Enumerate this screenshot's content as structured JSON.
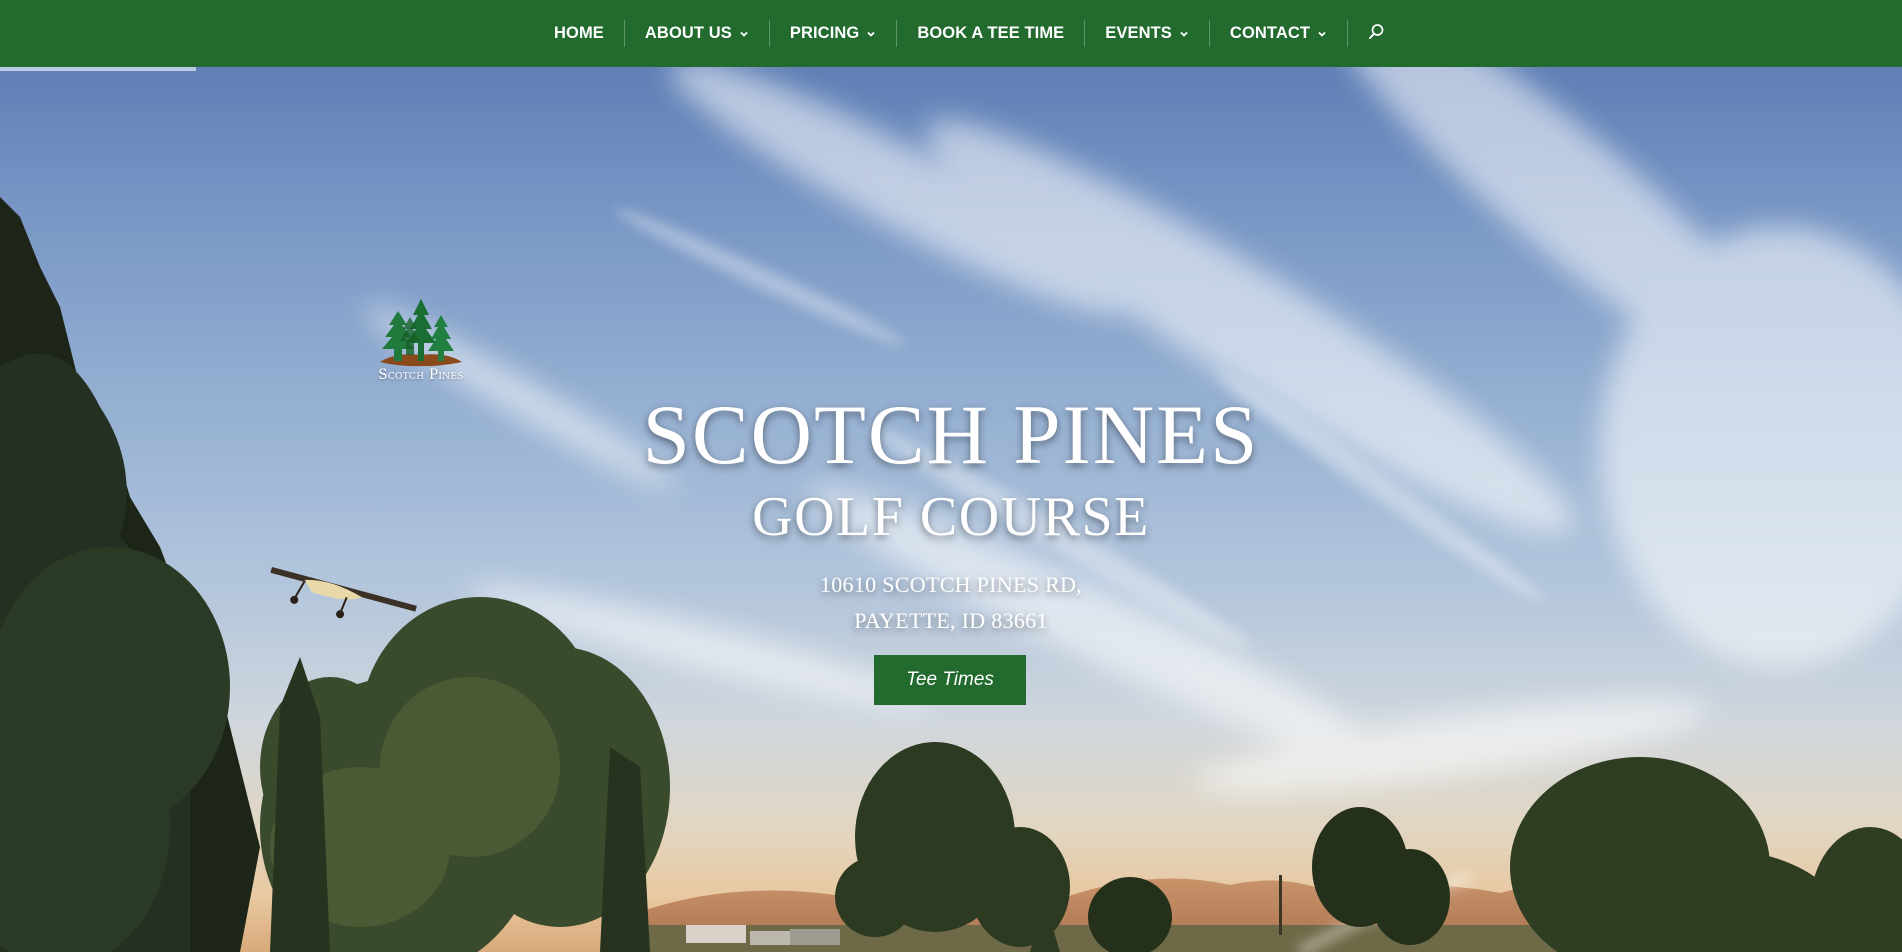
{
  "nav": {
    "items": [
      {
        "label": "HOME",
        "has_dropdown": false
      },
      {
        "label": "ABOUT US",
        "has_dropdown": true
      },
      {
        "label": "PRICING",
        "has_dropdown": true
      },
      {
        "label": "BOOK A TEE TIME",
        "has_dropdown": false
      },
      {
        "label": "EVENTS",
        "has_dropdown": true
      },
      {
        "label": "CONTACT",
        "has_dropdown": true
      }
    ],
    "search_icon": "search-icon"
  },
  "logo": {
    "text": "Scotch Pines",
    "icon": "pine-trees-logo"
  },
  "hero": {
    "title_line1": "SCOTCH PINES",
    "title_line2": "GOLF COURSE",
    "address_line1": "10610 SCOTCH PINES RD,",
    "address_line2": "PAYETTE, ID 83661",
    "cta_label": "Tee Times"
  },
  "colors": {
    "nav_background": "#226a2e",
    "cta_background": "#226a2e",
    "text": "#ffffff"
  }
}
